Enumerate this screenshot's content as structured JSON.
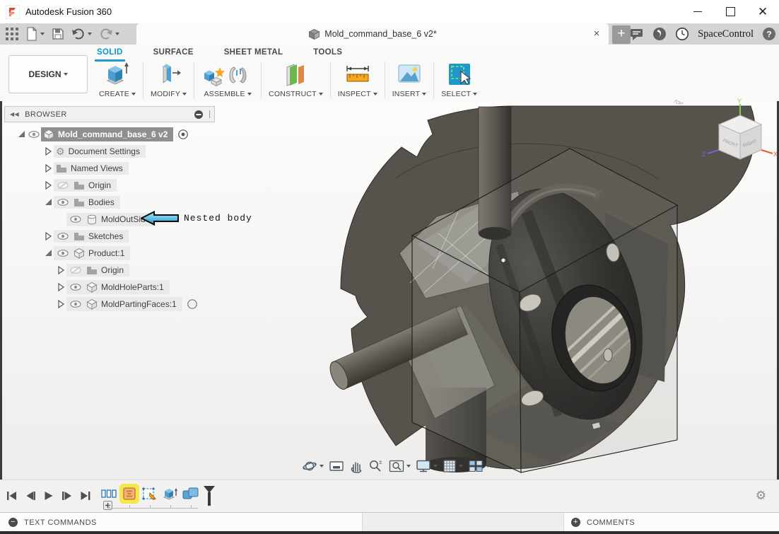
{
  "window": {
    "title": "Autodesk Fusion 360",
    "controls": {
      "minimize": "minimize",
      "maximize": "maximize",
      "close": "close"
    }
  },
  "quick_access": {
    "icons": [
      "app-grid-icon",
      "file-icon",
      "save-icon",
      "undo-icon",
      "redo-icon"
    ]
  },
  "document_tab": {
    "title": "Mold_command_base_6 v2*",
    "close_glyph": "×",
    "new_tab_glyph": "+"
  },
  "topbar_right": {
    "icons": [
      "comments-bubble-icon",
      "job-status-icon",
      "time-icon",
      "help-icon"
    ],
    "user": "SpaceControl"
  },
  "ribbon": {
    "workspace": "DESIGN",
    "tabs": [
      {
        "label": "SOLID",
        "active": true
      },
      {
        "label": "SURFACE",
        "active": false
      },
      {
        "label": "SHEET METAL",
        "active": false
      },
      {
        "label": "TOOLS",
        "active": false
      }
    ],
    "groups": [
      {
        "label": "CREATE",
        "icon": "create-icon"
      },
      {
        "label": "MODIFY",
        "icon": "modify-icon"
      },
      {
        "label": "ASSEMBLE",
        "icon": "assemble-icon"
      },
      {
        "label": "CONSTRUCT",
        "icon": "construct-icon"
      },
      {
        "label": "INSPECT",
        "icon": "inspect-icon"
      },
      {
        "label": "INSERT",
        "icon": "insert-icon"
      },
      {
        "label": "SELECT",
        "icon": "select-icon"
      }
    ]
  },
  "browser": {
    "header": "BROWSER",
    "header_icons": [
      "collapse-panel-icon",
      "minus-circle-icon"
    ],
    "tree": [
      {
        "label": "Mold_command_base_6 v2",
        "level": 0,
        "arrow": "expanded",
        "eye": "visible",
        "icon": "document",
        "selected": true,
        "after": "radio"
      },
      {
        "label": "Document Settings",
        "level": 1,
        "arrow": "collapsed",
        "eye": "none",
        "icon": "gear",
        "selected": false,
        "after": ""
      },
      {
        "label": "Named Views",
        "level": 1,
        "arrow": "collapsed",
        "eye": "none",
        "icon": "folder",
        "selected": false,
        "after": ""
      },
      {
        "label": "Origin",
        "level": 1,
        "arrow": "collapsed",
        "eye": "hidden",
        "icon": "folder",
        "selected": false,
        "after": ""
      },
      {
        "label": "Bodies",
        "level": 1,
        "arrow": "expanded",
        "eye": "visible",
        "icon": "folder",
        "selected": false,
        "after": ""
      },
      {
        "label": "MoldOutSide",
        "level": 2,
        "arrow": "none",
        "eye": "visible",
        "icon": "body",
        "selected": false,
        "after": ""
      },
      {
        "label": "Sketches",
        "level": 1,
        "arrow": "collapsed",
        "eye": "visible",
        "icon": "folder",
        "selected": false,
        "after": ""
      },
      {
        "label": "Product:1",
        "level": 1,
        "arrow": "expanded",
        "eye": "visible",
        "icon": "component",
        "selected": false,
        "after": ""
      },
      {
        "label": "Origin",
        "level": 2,
        "arrow": "collapsed",
        "eye": "hidden",
        "icon": "folder",
        "selected": false,
        "after": ""
      },
      {
        "label": "MoldHoleParts:1",
        "level": 2,
        "arrow": "collapsed",
        "eye": "visible",
        "icon": "component",
        "selected": false,
        "after": ""
      },
      {
        "label": "MoldPartingFaces:1",
        "level": 2,
        "arrow": "collapsed",
        "eye": "visible",
        "icon": "component",
        "selected": false,
        "after": "circle"
      }
    ]
  },
  "annotation": {
    "label": "Nested body",
    "arrow_color": "#45b6e8"
  },
  "viewcube": {
    "top": "TOP",
    "front": "FRONT",
    "right": "RIGHT",
    "axis_x": "X",
    "axis_y": "Y",
    "axis_z": "Z"
  },
  "nav_toolbar": {
    "items": [
      {
        "icon": "orbit-icon",
        "caret": true
      },
      {
        "icon": "look-at-icon",
        "caret": false
      },
      {
        "icon": "pan-icon",
        "caret": false
      },
      {
        "icon": "zoom-icon",
        "caret": false
      },
      {
        "icon": "fit-icon",
        "caret": true
      },
      {
        "icon": "display-settings-icon",
        "caret": true
      },
      {
        "icon": "grid-layout-icon",
        "caret": true
      },
      {
        "icon": "viewports-icon",
        "caret": true
      }
    ]
  },
  "timeline": {
    "playback": [
      "skip-start-icon",
      "step-back-icon",
      "play-icon",
      "step-forward-icon",
      "skip-end-icon"
    ],
    "features": [
      {
        "icon": "component-group-icon",
        "highlighted": false
      },
      {
        "icon": "form-feature-icon",
        "highlighted": true
      },
      {
        "icon": "sketch-feature-icon",
        "highlighted": false
      },
      {
        "icon": "extrude-feature-icon",
        "highlighted": false
      },
      {
        "icon": "combine-feature-icon",
        "highlighted": false
      }
    ],
    "marker": "playhead-marker",
    "zoom_button": "+",
    "settings_icon": "gear-icon"
  },
  "status_bar": {
    "left": "TEXT COMMANDS",
    "right": "COMMENTS"
  },
  "colors": {
    "accent_blue": "#0696d7",
    "highlight_yellow": "#f3e84a",
    "annotation_arrow": "#45b6e8",
    "mold_disc": "#57534c",
    "toolbar_gray": "#d4d4d4"
  }
}
